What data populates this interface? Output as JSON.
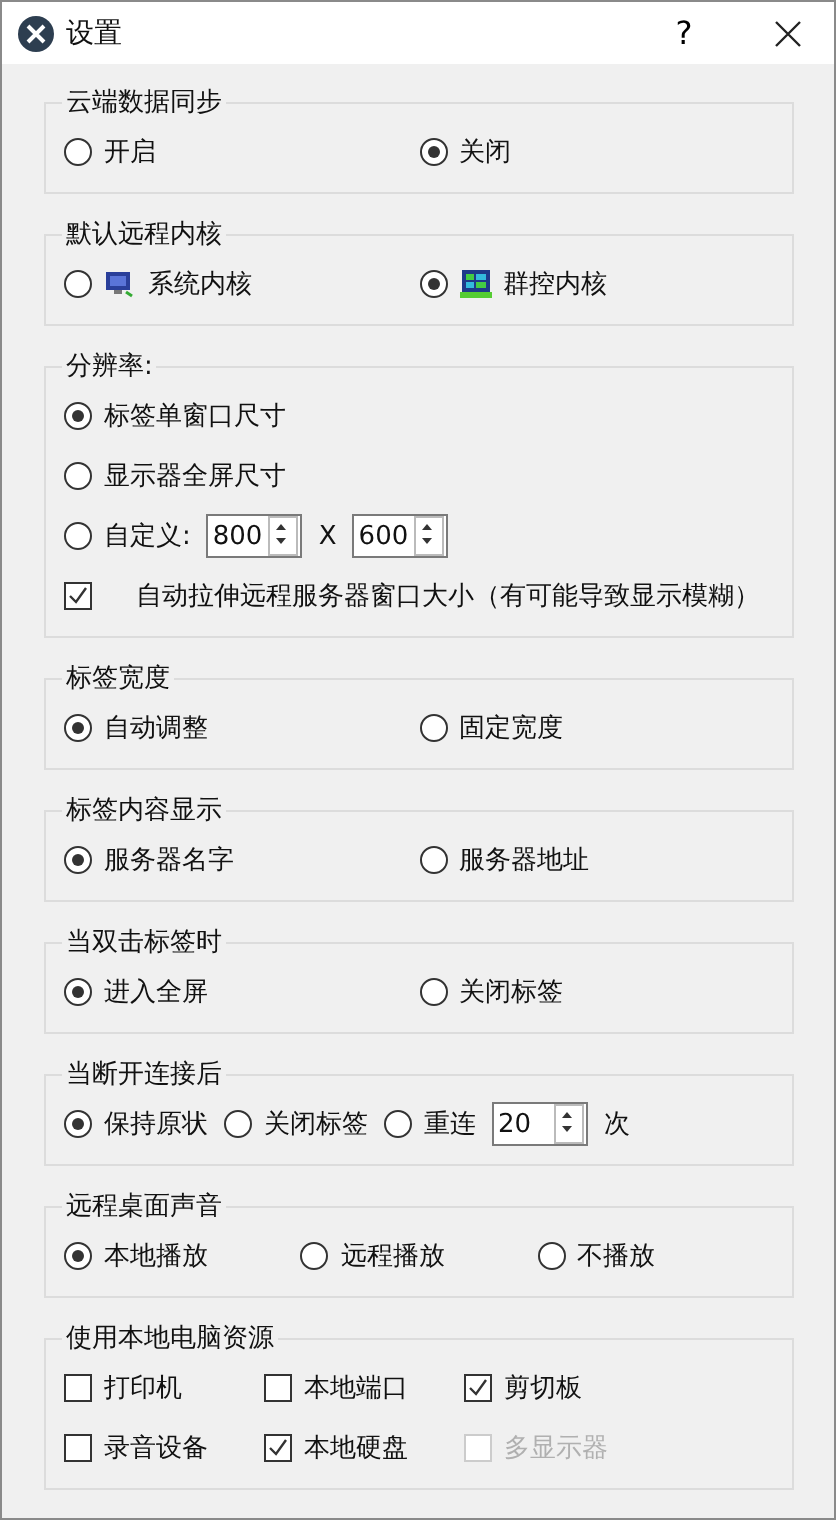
{
  "window": {
    "title": "设置",
    "help": "?"
  },
  "groups": [
    {
      "title": "云端数据同步",
      "rows": [
        {
          "kind": "grid",
          "items": [
            {
              "kind": "radio",
              "label": "开启",
              "selected": false
            },
            {
              "kind": "radio",
              "label": "关闭",
              "selected": true
            }
          ]
        }
      ]
    },
    {
      "title": "默认远程内核",
      "rows": [
        {
          "kind": "grid",
          "items": [
            {
              "kind": "iconradio",
              "label": "系统内核",
              "selected": false
            },
            {
              "kind": "iconradio",
              "label": "群控内核",
              "selected": true
            }
          ]
        }
      ]
    },
    {
      "title": "分辨率:",
      "rows": [
        {
          "kind": "inline",
          "items": [
            {
              "kind": "radio",
              "label": "标签单窗口尺寸",
              "selected": true
            }
          ]
        },
        {
          "kind": "inline",
          "items": [
            {
              "kind": "radio",
              "label": "显示器全屏尺寸",
              "selected": false
            }
          ]
        },
        {
          "kind": "inline",
          "items": [
            {
              "kind": "radio",
              "label": "自定义:",
              "selected": false
            },
            {
              "kind": "spin",
              "value": "800"
            },
            {
              "kind": "text",
              "label": "X"
            },
            {
              "kind": "spin",
              "value": "600"
            }
          ]
        },
        {
          "kind": "inline",
          "items": [
            {
              "kind": "checkbox",
              "label": "自动拉伸远程服务器窗口大小（有可能导致显示模糊）",
              "checked": true,
              "disabled": false
            }
          ]
        }
      ]
    },
    {
      "title": "标签宽度",
      "rows": [
        {
          "kind": "grid",
          "items": [
            {
              "kind": "radio",
              "label": "自动调整",
              "selected": true
            },
            {
              "kind": "radio",
              "label": "固定宽度",
              "selected": false
            }
          ]
        }
      ]
    },
    {
      "title": "标签内容显示",
      "rows": [
        {
          "kind": "grid",
          "items": [
            {
              "kind": "radio",
              "label": "服务器名字",
              "selected": true
            },
            {
              "kind": "radio",
              "label": "服务器地址",
              "selected": false
            }
          ]
        }
      ]
    },
    {
      "title": "当双击标签时",
      "rows": [
        {
          "kind": "grid",
          "items": [
            {
              "kind": "radio",
              "label": "进入全屏",
              "selected": true
            },
            {
              "kind": "radio",
              "label": "关闭标签",
              "selected": false
            }
          ]
        }
      ]
    },
    {
      "title": "当断开连接后",
      "rows": [
        {
          "kind": "inline",
          "items": [
            {
              "kind": "radio",
              "label": "保持原状",
              "selected": true
            },
            {
              "kind": "radio",
              "label": "关闭标签",
              "selected": false
            },
            {
              "kind": "radio",
              "label": "重连",
              "selected": false
            },
            {
              "kind": "spin",
              "value": "20"
            },
            {
              "kind": "text",
              "label": "次"
            }
          ]
        }
      ]
    },
    {
      "title": "远程桌面声音",
      "rows": [
        {
          "kind": "grid",
          "items": [
            {
              "kind": "radio",
              "label": "本地播放",
              "selected": true
            },
            {
              "kind": "radio",
              "label": "远程播放",
              "selected": false
            },
            {
              "kind": "radio",
              "label": "不播放",
              "selected": false
            }
          ]
        }
      ]
    },
    {
      "title": "使用本地电脑资源",
      "rows": [
        {
          "kind": "checks",
          "items": [
            {
              "kind": "checkbox",
              "label": "打印机",
              "checked": false,
              "disabled": false
            },
            {
              "kind": "checkbox",
              "label": "本地端口",
              "checked": false,
              "disabled": false
            },
            {
              "kind": "checkbox",
              "label": "剪切板",
              "checked": true,
              "disabled": false
            }
          ]
        },
        {
          "kind": "checks",
          "items": [
            {
              "kind": "checkbox",
              "label": "录音设备",
              "checked": false,
              "disabled": false
            },
            {
              "kind": "checkbox",
              "label": "本地硬盘",
              "checked": true,
              "disabled": false
            },
            {
              "kind": "checkbox",
              "label": "多显示器",
              "checked": false,
              "disabled": true
            }
          ]
        }
      ]
    }
  ]
}
